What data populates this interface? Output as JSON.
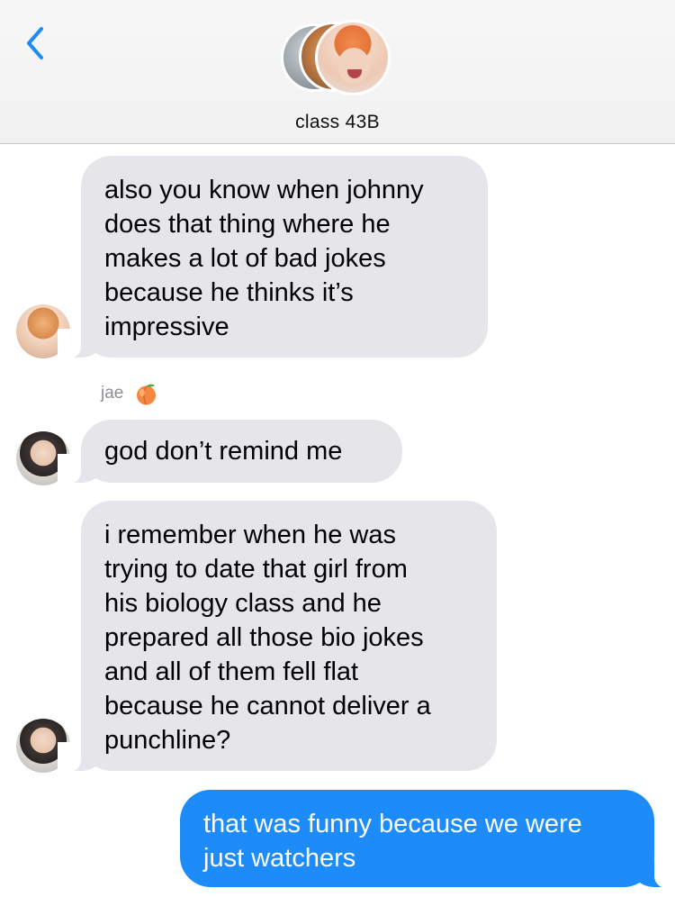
{
  "header": {
    "group_name": "class 43B",
    "back_icon": "chevron-left-icon",
    "accent_color": "#1d8cf8"
  },
  "messages": [
    {
      "direction": "incoming",
      "sender": "",
      "lines": [
        "also you know when johnny",
        "does that thing where he",
        "makes a lot of bad jokes",
        "because he thinks it’s",
        "impressive"
      ]
    },
    {
      "direction": "incoming",
      "sender": "jae",
      "sender_emoji": "peach-emoji",
      "lines": [
        "god don’t remind me"
      ]
    },
    {
      "direction": "incoming",
      "sender": "jae",
      "lines": [
        "i remember when he was",
        "trying to date that girl from",
        "his biology class and he",
        "prepared all those bio jokes",
        "and all of them fell flat",
        "because he cannot deliver a",
        "punchline?"
      ]
    },
    {
      "direction": "outgoing",
      "lines": [
        "that was funny because we were",
        "just watchers"
      ]
    }
  ],
  "colors": {
    "incoming_bubble": "#e5e5ea",
    "outgoing_bubble": "#1d8cf8",
    "sender_label": "#8e8e93"
  }
}
